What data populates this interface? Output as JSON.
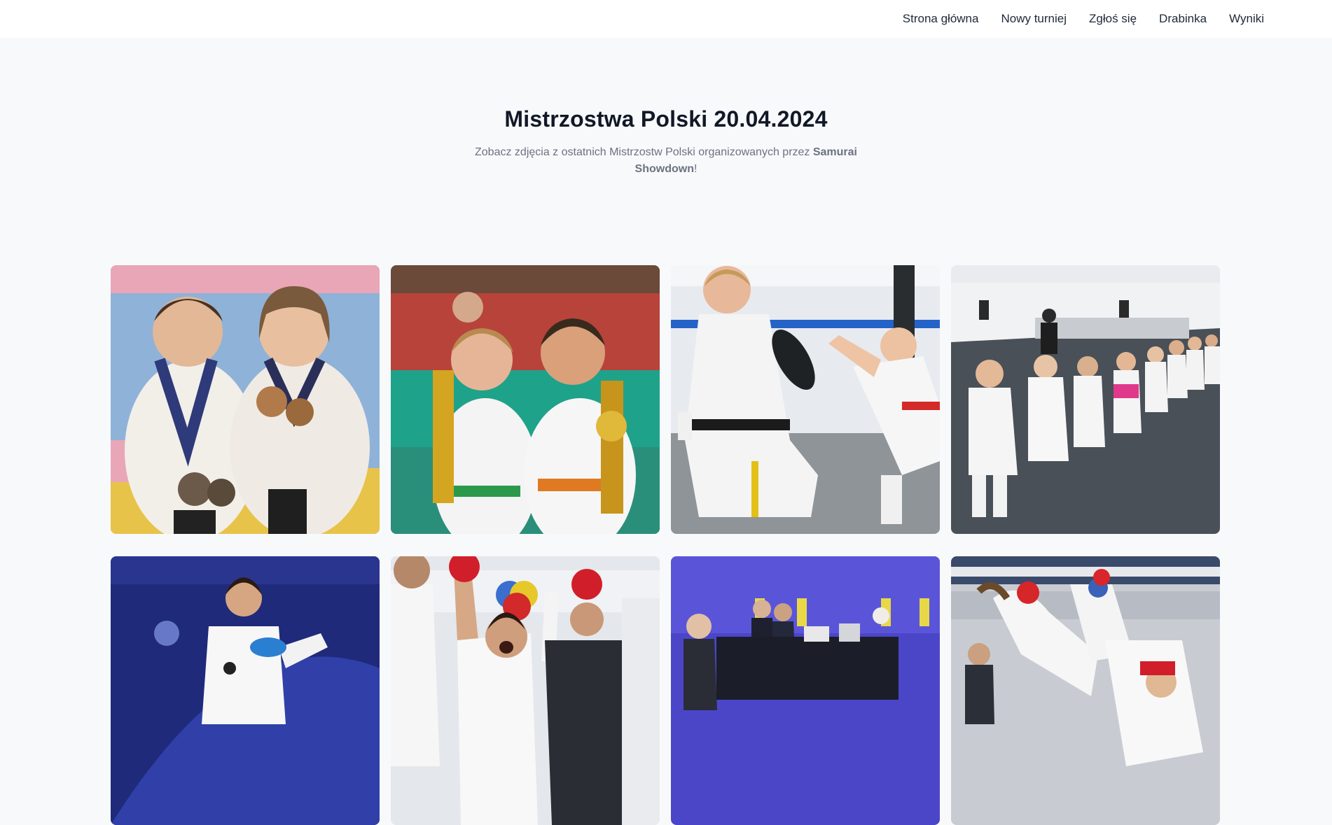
{
  "nav": {
    "items": [
      {
        "label": "Strona główna"
      },
      {
        "label": "Nowy turniej"
      },
      {
        "label": "Zgłoś się"
      },
      {
        "label": "Drabinka"
      },
      {
        "label": "Wyniki"
      }
    ]
  },
  "hero": {
    "title": "Mistrzostwa Polski 20.04.2024",
    "subtitle_prefix": "Zobacz zdjęcia z ostatnich Mistrzostw Polski organizowanych przez ",
    "subtitle_brand": "Samurai Showdown",
    "subtitle_suffix": "!"
  },
  "gallery": {
    "photos": [
      {
        "subject": "two-kids-with-medals"
      },
      {
        "subject": "two-boys-with-trophies"
      },
      {
        "subject": "kick-training-with-pad"
      },
      {
        "subject": "kids-lined-up-in-dojo"
      },
      {
        "subject": "karate-champion-celebrating"
      },
      {
        "subject": "kumite-winner-raised-arm"
      },
      {
        "subject": "judges-table-at-tournament"
      },
      {
        "subject": "sparring-match-kick"
      }
    ]
  }
}
